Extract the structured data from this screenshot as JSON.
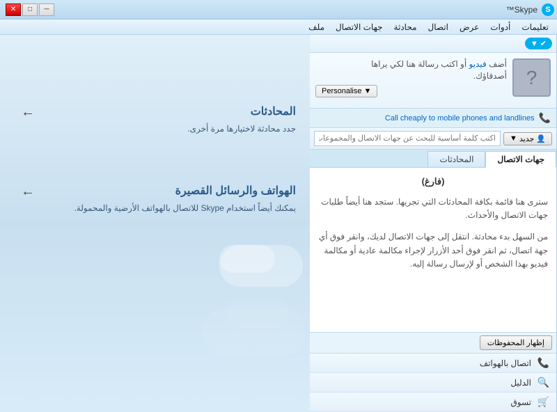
{
  "titlebar": {
    "app_name": "Skype™",
    "controls": {
      "minimize": "─",
      "maximize": "□",
      "close": "✕"
    }
  },
  "menubar": {
    "items": [
      {
        "label": "تعليمات"
      },
      {
        "label": "أدوات"
      },
      {
        "label": "عرض"
      },
      {
        "label": "اتصال"
      },
      {
        "label": "محادثة"
      },
      {
        "label": "جهات الاتصال"
      },
      {
        "label": "ملف"
      }
    ]
  },
  "profile": {
    "message_part1": "أضف ",
    "message_link": "فيديو",
    "message_part2": " أو اكتب رسالة هنا لكي يراها",
    "message_part3": "أصدقاؤك.",
    "personalise_btn": "Personalise"
  },
  "call_promo": {
    "text": "Call cheaply to mobile phones and landlines"
  },
  "search": {
    "new_btn": "جديد",
    "placeholder": "اكتب كلمة أساسية للبحث عن جهات الاتصال والمجموعات"
  },
  "tabs": {
    "conversations": "المحادثات",
    "contacts": "جهات الاتصال"
  },
  "content": {
    "empty_title": "(فارغ)",
    "empty_desc1": "ستری هنا قائمة بكافة المحادثات التي تجريها. ستجد هنا أيضاً طلبات جهات الاتصال والأحداث.",
    "empty_desc2_part1": "من السهل بدء محادثة. انتقل إلى ",
    "empty_desc2_link": "جهات الاتصال",
    "empty_desc2_part2": " لديك، وانقر فوق أي جهة اتصال، ثم انقر فوق أحد الأزرار لإجراء مكالمة عادية أو مكالمة فيديو بهذا الشخص أو لإرسال رسالة إليه."
  },
  "bottom": {
    "show_saved_btn": "إظهار المحفوظات",
    "nav_items": [
      {
        "icon": "📞",
        "label": "اتصال بالهواتف"
      },
      {
        "icon": "🔍",
        "label": "الدليل"
      },
      {
        "icon": "🛒",
        "label": "تسوق"
      }
    ]
  },
  "right_panel": {
    "sections": [
      {
        "title": "المحادثات",
        "text": "جدد محادثة لاختيارها مرة أخرى."
      },
      {
        "title": "الهواتف والرسائل القصيرة",
        "text": "يمكنك أيضاً استخدام Skype للاتصال بالهواتف الأرضية والمحمولة."
      }
    ]
  }
}
